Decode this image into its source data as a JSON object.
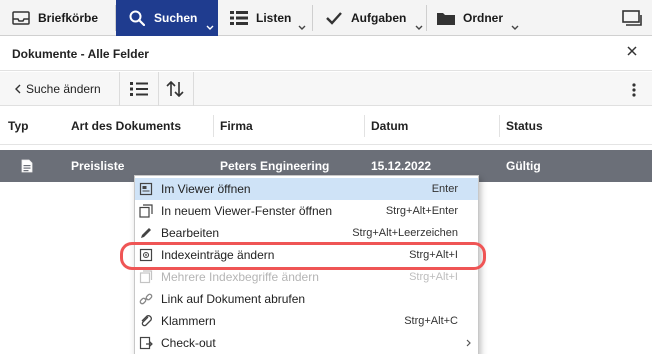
{
  "toolbar": {
    "items": [
      {
        "label": "Briefkörbe",
        "icon": "inbox-icon"
      },
      {
        "label": "Suchen",
        "icon": "search-icon",
        "active": true
      },
      {
        "label": "Listen",
        "icon": "list-grid-icon"
      },
      {
        "label": "Aufgaben",
        "icon": "checkmark-icon"
      },
      {
        "label": "Ordner",
        "icon": "folder-icon"
      }
    ],
    "window_icon": "window-icon"
  },
  "panel": {
    "title": "Dokumente - Alle Felder",
    "close_icon": "close-icon"
  },
  "subtoolbar": {
    "back_label": "Suche ändern",
    "icons": [
      "list-view-icon",
      "sort-icon",
      "more-vertical-icon"
    ]
  },
  "table": {
    "columns": [
      "Typ",
      "Art des Dokuments",
      "Firma",
      "Datum",
      "Status"
    ],
    "rows": [
      {
        "type_icon": "document-icon",
        "art": "Preisliste",
        "firma": "Peters Engineering",
        "datum": "15.12.2022",
        "status": "Gültig",
        "selected": true
      }
    ]
  },
  "context_menu": {
    "items": [
      {
        "label": "Im Viewer öffnen",
        "shortcut": "Enter",
        "icon": "viewer-icon",
        "state": "highlighted"
      },
      {
        "label": "In neuem Viewer-Fenster öffnen",
        "shortcut": "Strg+Alt+Enter",
        "icon": "new-window-icon"
      },
      {
        "label": "Bearbeiten",
        "shortcut": "Strg+Alt+Leerzeichen",
        "icon": "pencil-icon"
      },
      {
        "label": "Indexeinträge ändern",
        "shortcut": "Strg+Alt+I",
        "icon": "index-edit-icon",
        "state": "focused"
      },
      {
        "label": "Mehrere Indexbegriffe ändern",
        "shortcut": "Strg+Alt+I",
        "icon": "multi-index-icon",
        "state": "disabled"
      },
      {
        "label": "Link auf Dokument abrufen",
        "shortcut": "",
        "icon": "link-icon"
      },
      {
        "label": "Klammern",
        "shortcut": "Strg+Alt+C",
        "icon": "paperclip-icon"
      },
      {
        "label": "Check-out",
        "shortcut": "",
        "icon": "checkout-icon",
        "submenu": true
      }
    ]
  },
  "colors": {
    "active_toolbar": "#1f3c8f",
    "selected_row": "#6b6f78",
    "menu_highlight": "#cfe3f7",
    "focus_ring": "#ef5555"
  }
}
